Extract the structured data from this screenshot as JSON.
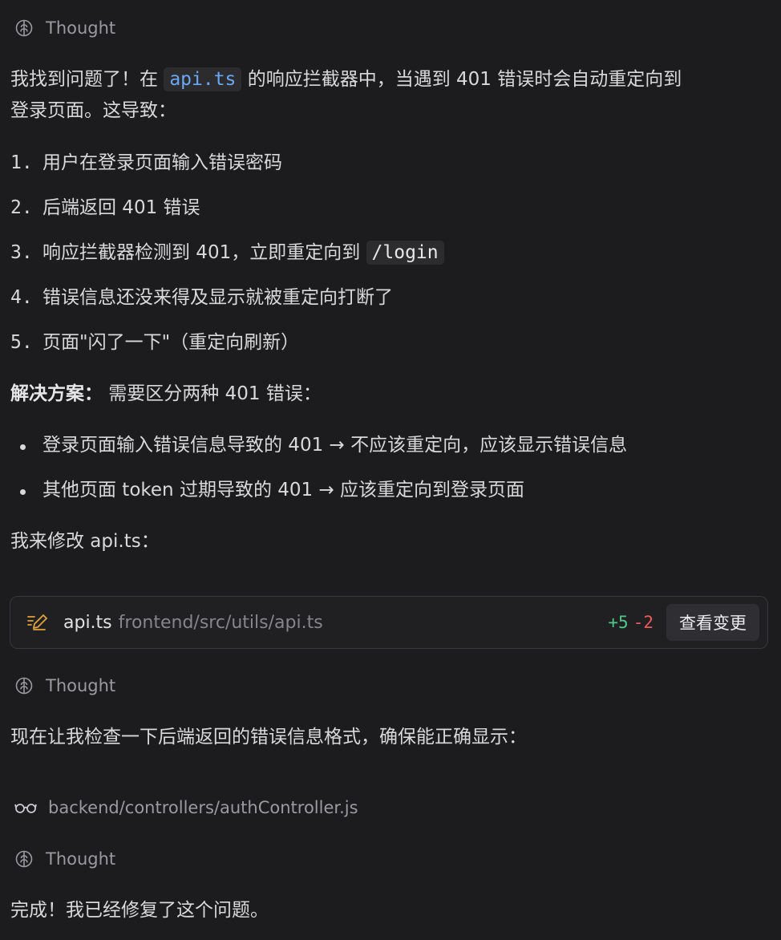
{
  "thought_label": "Thought",
  "intro": {
    "pre": "我找到问题了！在 ",
    "code": "api.ts",
    "post": " 的响应拦截器中，当遇到 401 错误时会自动重定向到",
    "line2": "登录页面。这导致："
  },
  "steps": [
    {
      "num": "1.",
      "text": "用户在登录页面输入错误密码"
    },
    {
      "num": "2.",
      "text": "后端返回 401 错误"
    },
    {
      "num": "3.",
      "text": "响应拦截器检测到 401，立即重定向到 ",
      "code": "/login"
    },
    {
      "num": "4.",
      "text": "错误信息还没来得及显示就被重定向打断了"
    },
    {
      "num": "5.",
      "text": "页面\"闪了一下\"（重定向刷新）"
    }
  ],
  "solution": {
    "label": "解决方案：",
    "text": " 需要区分两种 401 错误："
  },
  "bullets": [
    "登录页面输入错误信息导致的 401 → 不应该重定向，应该显示错误信息",
    "其他页面 token 过期导致的 401 → 应该重定向到登录页面"
  ],
  "modify_text": "我来修改 api.ts：",
  "file_card": {
    "icon": "edit-icon",
    "name": "api.ts",
    "path": "frontend/src/utils/api.ts",
    "additions": "+5",
    "deletions": "-2",
    "view_button": "查看变更",
    "add_color": "#4ec98a",
    "del_color": "#ef5a5a"
  },
  "check_text": "现在让我检查一下后端返回的错误信息格式，确保能正确显示：",
  "read_file": {
    "icon": "glasses-icon",
    "path": "backend/controllers/authController.js"
  },
  "done_text": "完成！我已经修复了这个问题。"
}
